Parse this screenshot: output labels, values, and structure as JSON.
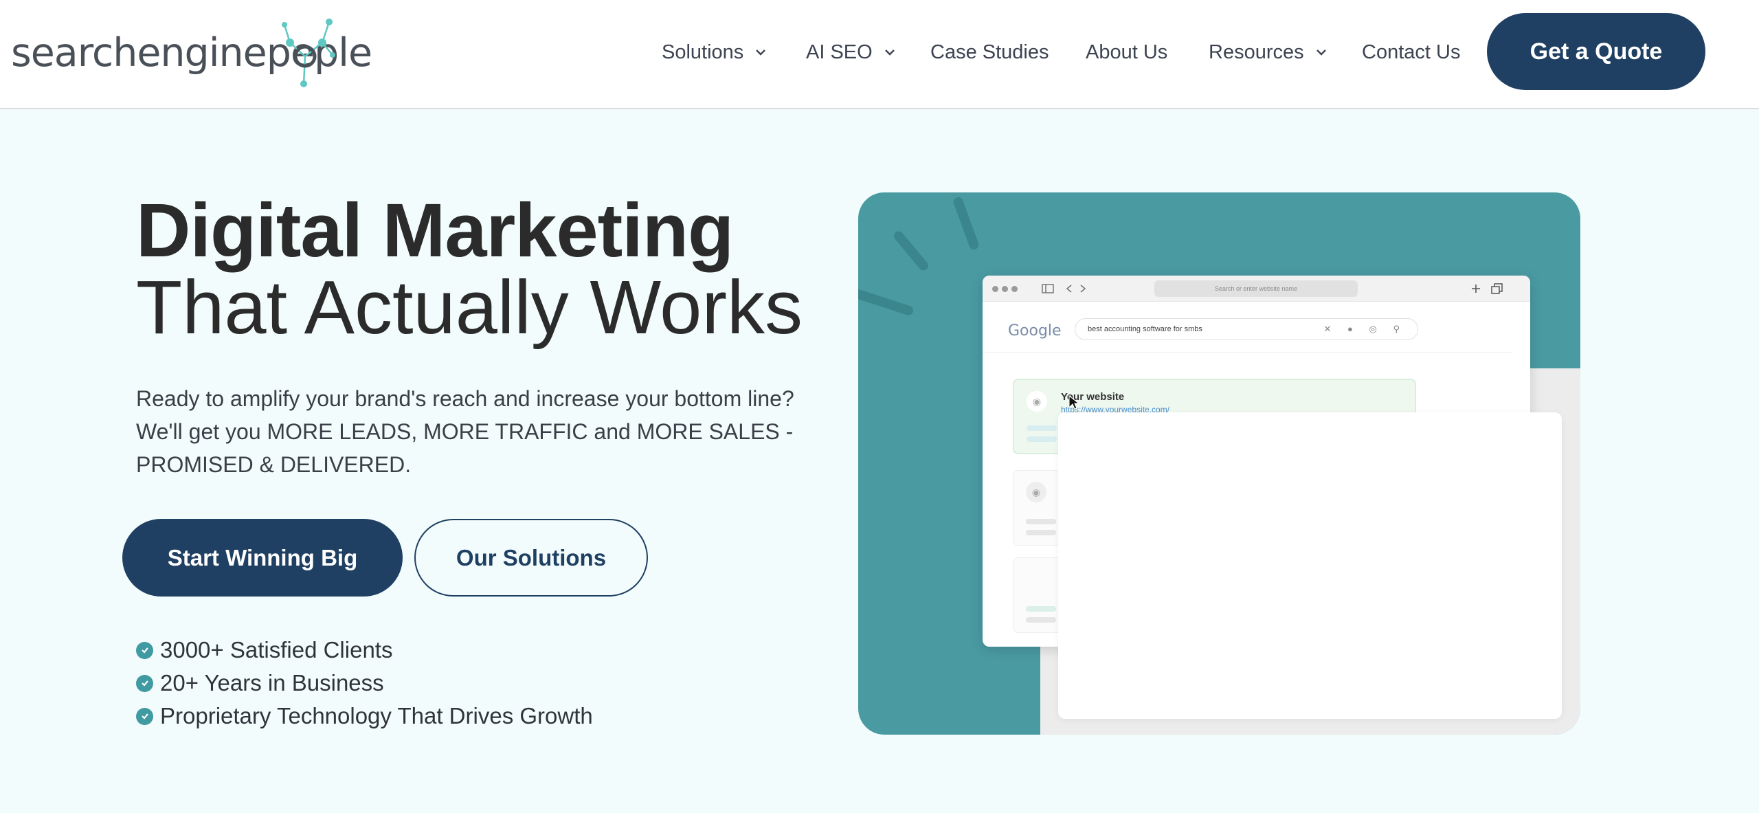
{
  "header": {
    "logo_text_a": "searchengine",
    "logo_text_b": "pe",
    "logo_text_c": "ple",
    "nav": [
      {
        "label": "Solutions",
        "has_dropdown": true,
        "icon": "chevron-down-icon"
      },
      {
        "label": "AI SEO",
        "has_dropdown": true,
        "icon": "chevron-down-icon"
      },
      {
        "label": "Case Studies",
        "has_dropdown": false
      },
      {
        "label": "About Us",
        "has_dropdown": false
      },
      {
        "label": "Resources",
        "has_dropdown": true,
        "icon": "chevron-down-icon"
      },
      {
        "label": "Contact Us",
        "has_dropdown": false
      }
    ],
    "cta_label": "Get a Quote"
  },
  "hero": {
    "title_line1": "Digital Marketing",
    "title_line2": "That Actually Works",
    "subtitle_lines": [
      "Ready to amplify your brand's reach and increase your bottom line?",
      "We'll get you MORE LEADS, MORE TRAFFIC and MORE SALES -",
      "PROMISED & DELIVERED."
    ],
    "primary_cta": "Start Winning Big",
    "secondary_cta": "Our Solutions",
    "bullets": [
      "3000+ Satisfied Clients",
      "20+ Years in Business",
      "Proprietary Technology That Drives Growth"
    ]
  },
  "illustration": {
    "url_placeholder": "Search or enter website name",
    "search_engine_name": "Google",
    "search_query": "best accounting software for smbs",
    "result_title": "Your website",
    "result_url": "https://www.yourwebsite.com/"
  },
  "colors": {
    "brand_navy": "#1f4062",
    "teal": "#4a9aa2",
    "page_bg": "#f3fcfc"
  }
}
